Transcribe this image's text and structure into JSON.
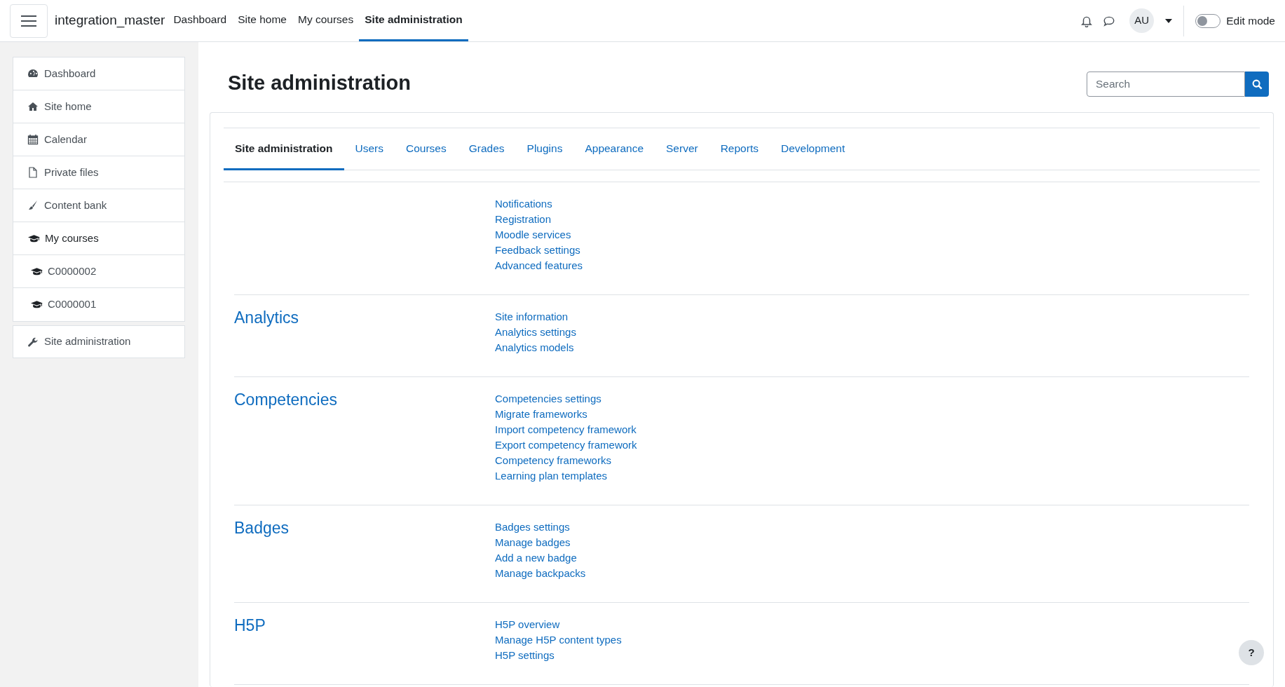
{
  "navbar": {
    "site_name": "integration_master",
    "links": [
      {
        "label": "Dashboard",
        "selected": false
      },
      {
        "label": "Site home",
        "selected": false
      },
      {
        "label": "My courses",
        "selected": false
      },
      {
        "label": "Site administration",
        "selected": true
      }
    ],
    "avatar": "AU",
    "edit_mode": {
      "label": "Edit mode",
      "on": false
    }
  },
  "sidebar": {
    "items": [
      {
        "label": "Dashboard",
        "kind": "link"
      },
      {
        "label": "Site home",
        "kind": "link"
      },
      {
        "label": "Calendar",
        "kind": "link"
      },
      {
        "label": "Private files",
        "kind": "link"
      },
      {
        "label": "Content bank",
        "kind": "link"
      },
      {
        "label": "My courses",
        "kind": "heading"
      },
      {
        "label": "C0000002",
        "kind": "course"
      },
      {
        "label": "C0000001",
        "kind": "course"
      }
    ],
    "admin_item": {
      "label": "Site administration"
    }
  },
  "page": {
    "title": "Site administration",
    "search": {
      "placeholder": "Search"
    },
    "tabs": [
      {
        "label": "Site administration",
        "selected": true
      },
      {
        "label": "Users",
        "selected": false
      },
      {
        "label": "Courses",
        "selected": false
      },
      {
        "label": "Grades",
        "selected": false
      },
      {
        "label": "Plugins",
        "selected": false
      },
      {
        "label": "Appearance",
        "selected": false
      },
      {
        "label": "Server",
        "selected": false
      },
      {
        "label": "Reports",
        "selected": false
      },
      {
        "label": "Development",
        "selected": false
      }
    ],
    "sections": [
      {
        "links": [
          "Notifications",
          "Registration",
          "Moodle services",
          "Feedback settings",
          "Advanced features"
        ]
      },
      {
        "heading": "Analytics",
        "links": [
          "Site information",
          "Analytics settings",
          "Analytics models"
        ]
      },
      {
        "heading": "Competencies",
        "links": [
          "Competencies settings",
          "Migrate frameworks",
          "Import competency framework",
          "Export competency framework",
          "Competency frameworks",
          "Learning plan templates"
        ]
      },
      {
        "heading": "Badges",
        "links": [
          "Badges settings",
          "Manage badges",
          "Add a new badge",
          "Manage backpacks"
        ]
      },
      {
        "heading": "H5P",
        "links": [
          "H5P overview",
          "Manage H5P content types",
          "H5P settings"
        ]
      }
    ]
  },
  "help_button": "?"
}
